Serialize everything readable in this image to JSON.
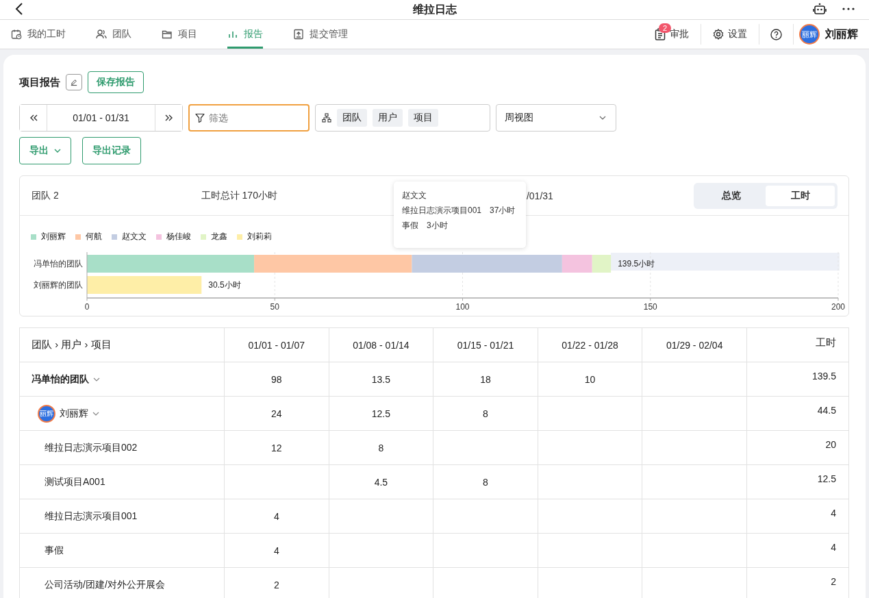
{
  "window": {
    "title": "维拉日志"
  },
  "nav_tabs": [
    {
      "label": "我的工时",
      "selected": false
    },
    {
      "label": "团队",
      "selected": false
    },
    {
      "label": "项目",
      "selected": false
    },
    {
      "label": "报告",
      "selected": true
    },
    {
      "label": "提交管理",
      "selected": false
    }
  ],
  "nav_actions": {
    "approval": {
      "label": "审批",
      "badge": "2"
    },
    "settings": {
      "label": "设置"
    },
    "user": {
      "avatar_text": "丽辉",
      "name": "刘丽辉"
    }
  },
  "report": {
    "title": "项目报告",
    "save_button": "保存报告",
    "date_range": "01/01 - 01/31",
    "filter": {
      "placeholder": "筛选"
    },
    "group_by": [
      "团队",
      "用户",
      "项目"
    ],
    "view_select": "周视图",
    "export_button": "导出",
    "export_history_button": "导出记录"
  },
  "summary": {
    "teams": "团队 2",
    "total": "工时总计 170小时",
    "period": "/01/31",
    "toggle": [
      {
        "label": "总览",
        "selected": false
      },
      {
        "label": "工时",
        "selected": true
      }
    ]
  },
  "tooltip": {
    "title": "赵文文",
    "lines": [
      {
        "name": "维拉日志演示项目001",
        "value": "37小时"
      },
      {
        "name": "事假",
        "value": "3小时"
      }
    ]
  },
  "chart_data": {
    "type": "bar",
    "orientation": "horizontal",
    "stacked": true,
    "categories": [
      "冯单怡的团队",
      "刘丽辉的团队"
    ],
    "series": [
      {
        "name": "刘丽辉",
        "color": "#a8dfc8",
        "values": [
          44.5,
          null
        ]
      },
      {
        "name": "何航",
        "color": "#fec7a5",
        "values": [
          42,
          null
        ]
      },
      {
        "name": "赵文文",
        "color": "#c3cde2",
        "values": [
          40,
          null
        ]
      },
      {
        "name": "杨佳峻",
        "color": "#f4c3df",
        "values": [
          8,
          null
        ]
      },
      {
        "name": "龙鑫",
        "color": "#e1f4c6",
        "values": [
          5,
          null
        ]
      },
      {
        "name": "刘莉莉",
        "color": "#feeea7",
        "values": [
          null,
          30.5
        ]
      }
    ],
    "xlim": [
      0,
      200
    ],
    "xticks": [
      0,
      50,
      100,
      150,
      200
    ],
    "grid": true,
    "legend": "top",
    "value_labels": [
      "139.5小时",
      "30.5小时"
    ]
  },
  "table": {
    "columns": [
      "团队 › 用户 › 项目",
      "01/01 - 01/07",
      "01/08 - 01/14",
      "01/15 - 01/21",
      "01/22 - 01/28",
      "01/29 - 02/04",
      "工时"
    ],
    "rows": [
      {
        "kind": "team",
        "expanded": true,
        "cells": [
          "冯单怡的团队",
          "98",
          "13.5",
          "18",
          "10",
          "",
          "139.5"
        ],
        "children": [
          {
            "kind": "user",
            "avatar_text": "丽辉",
            "expanded": true,
            "cells": [
              "刘丽辉",
              "24",
              "12.5",
              "8",
              "",
              "",
              "44.5"
            ],
            "children": [
              {
                "kind": "project",
                "cells": [
                  "维拉日志演示项目002",
                  "12",
                  "8",
                  "",
                  "",
                  "",
                  "20"
                ]
              },
              {
                "kind": "project",
                "cells": [
                  "测试项目A001",
                  "",
                  "4.5",
                  "8",
                  "",
                  "",
                  "12.5"
                ]
              },
              {
                "kind": "project",
                "cells": [
                  "维拉日志演示项目001",
                  "4",
                  "",
                  "",
                  "",
                  "",
                  "4"
                ]
              },
              {
                "kind": "project",
                "cells": [
                  "事假",
                  "4",
                  "",
                  "",
                  "",
                  "",
                  "4"
                ]
              },
              {
                "kind": "project",
                "cells": [
                  "公司活动/团建/对外公开展会",
                  "2",
                  "",
                  "",
                  "",
                  "",
                  "2"
                ]
              }
            ]
          }
        ]
      }
    ]
  }
}
